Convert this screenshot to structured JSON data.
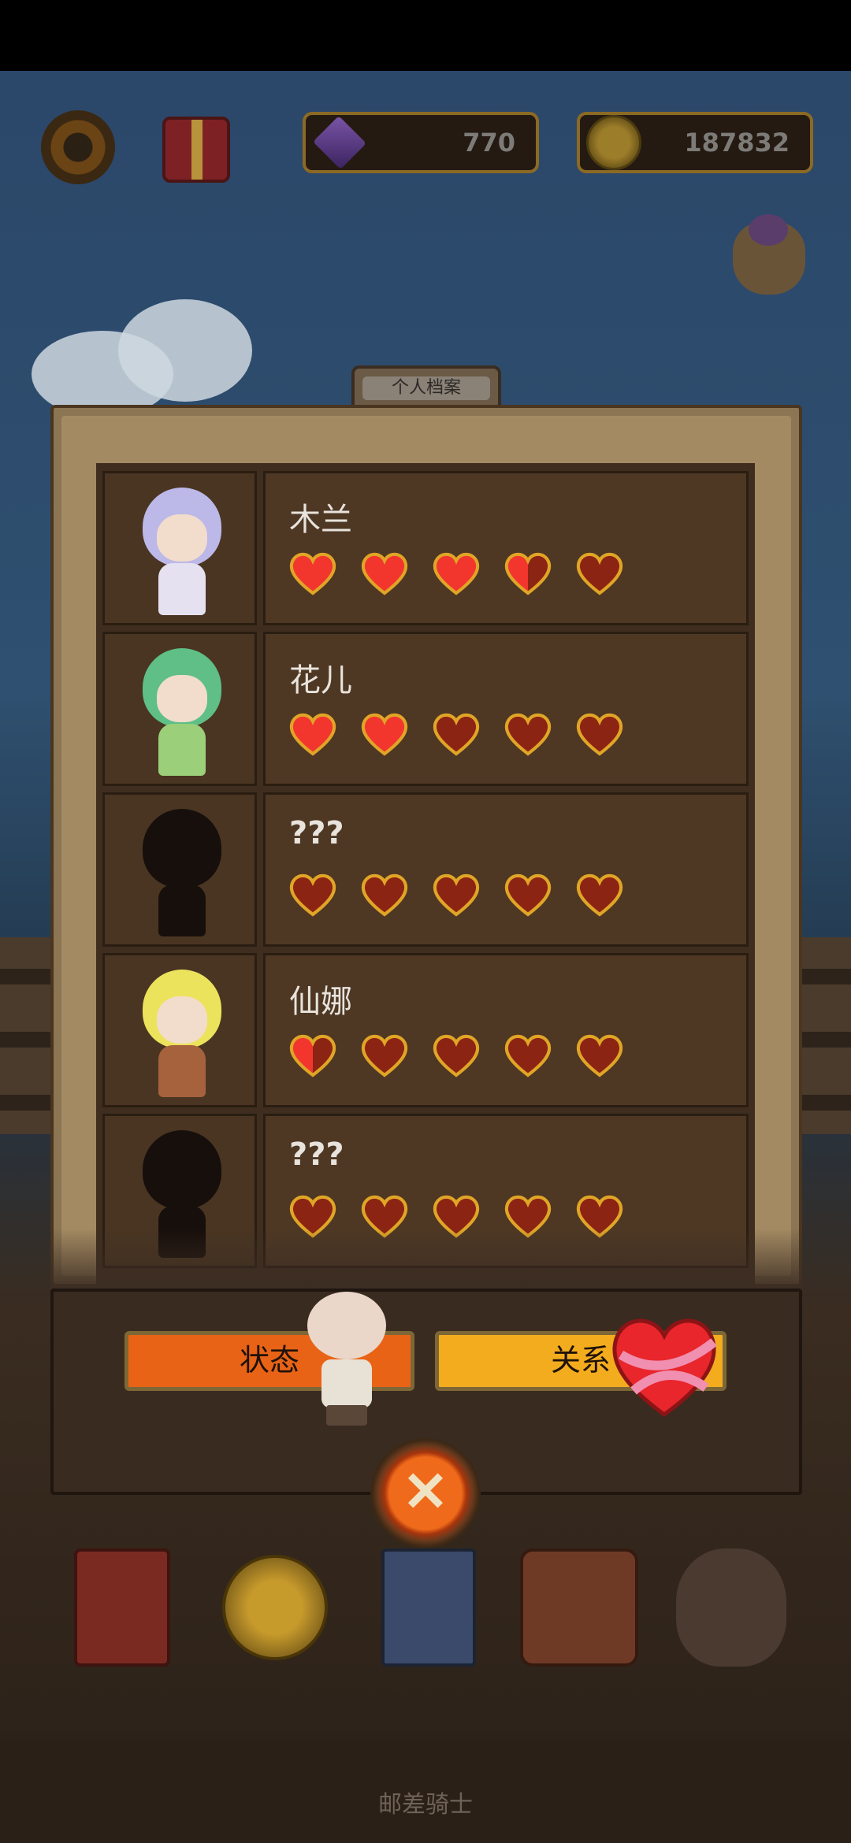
{
  "top_bar": {
    "gems": "770",
    "coins": "187832"
  },
  "tab_title": "个人档案",
  "characters": [
    {
      "name": "木兰",
      "hearts": [
        1,
        1,
        1,
        0.5,
        0
      ]
    },
    {
      "name": "花儿",
      "hearts": [
        1,
        1,
        0,
        0,
        0
      ]
    },
    {
      "name": "???",
      "hearts": [
        0,
        0,
        0,
        0,
        0
      ]
    },
    {
      "name": "仙娜",
      "hearts": [
        0.5,
        0,
        0,
        0,
        0
      ]
    },
    {
      "name": "???",
      "hearts": [
        0,
        0,
        0,
        0,
        0
      ]
    }
  ],
  "buttons": {
    "status": "状态",
    "relation": "关系"
  },
  "footer_title": "邮差骑士",
  "colors": {
    "heart_full": "#f2362e",
    "heart_empty": "#8c2414",
    "heart_border": "#e0a526"
  }
}
